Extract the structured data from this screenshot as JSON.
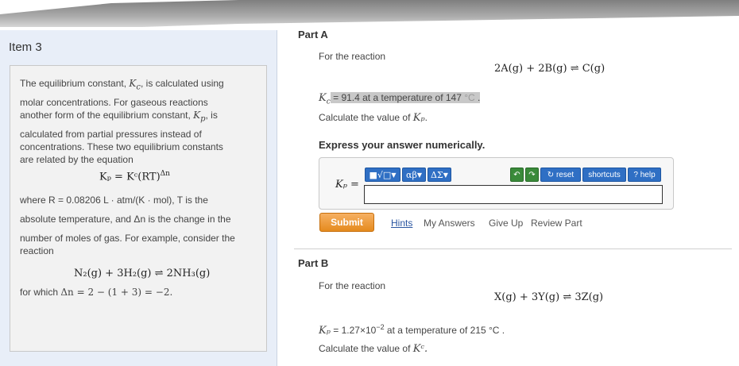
{
  "item_title": "Item 3",
  "intro": {
    "line1": "The equilibrium constant,",
    "line1_kc": "K",
    "line1_end": ", is calculated using",
    "line2": "molar concentrations. For gaseous reactions",
    "line3_a": "another form of the equilibrium constant,",
    "line3_kp": "K",
    "line3_end": ", is",
    "line4": "calculated from partial pressures instead of",
    "line5": "concentrations. These two equilibrium constants",
    "line6": "are related by the equation",
    "equation": "Kₚ = Kᶜ(RT)",
    "equation_exp": "Δn",
    "where_line": "where R = 0.08206 L · atm/(K · mol), T is the",
    "abs_line": "absolute temperature, and Δn is the change in the",
    "moles_line": "number of moles of gas. For example, consider the",
    "reaction_word": "reaction",
    "example_eq": "N₂(g) + 3H₂(g) ⇌ 2NH₃(g)",
    "for_which": "for which",
    "for_which_eq": "Δn = 2 − (1 + 3) = −2."
  },
  "part_a": {
    "label": "Part A",
    "for_reaction": "For the reaction",
    "reaction": "2A(g) + 2B(g) ⇌ C(g)",
    "kc_prefix": "K",
    "kc_text": " = 91.4 at a temperature of 147 ",
    "kc_unit": "°C",
    "calc": "Calculate the value of",
    "calc_var": "Kₚ",
    "express": "Express your answer numerically.",
    "input_label": "Kₚ =",
    "tools": {
      "templates": "■√□",
      "greek": "αβ",
      "sigma": "ΔΣ",
      "reset": "reset",
      "shortcuts": "shortcuts",
      "help": "help"
    },
    "submit": "Submit",
    "hints": "Hints",
    "my_answers": "My Answers",
    "give_up": "Give Up",
    "review": "Review Part"
  },
  "part_b": {
    "label": "Part B",
    "for_reaction": "For the reaction",
    "reaction": "X(g) + 3Y(g) ⇌ 3Z(g)",
    "kp_prefix": "Kₚ",
    "kp_text": " = 1.27×10",
    "kp_exp": "−2",
    "kp_end": " at a temperature of 215 °C .",
    "calc": "Calculate the value of",
    "calc_var": "Kᶜ."
  }
}
